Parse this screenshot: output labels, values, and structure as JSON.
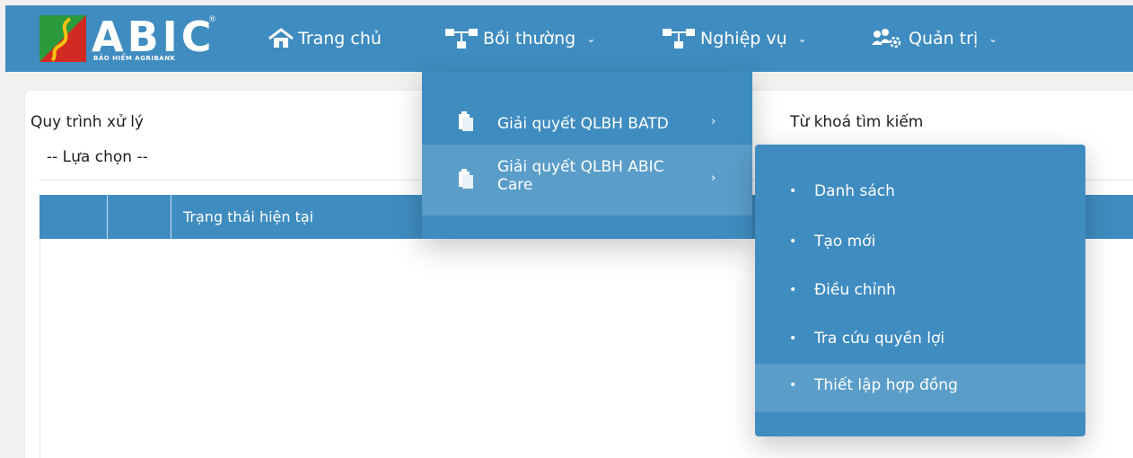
{
  "brand": {
    "name": "ABIC",
    "registered_mark": "®",
    "tagline": "BẢO HIỂM AGRIBANK",
    "colors": {
      "primary": "#3f8cc0",
      "logo_green": "#2a9a3c",
      "logo_red": "#d12a23"
    }
  },
  "nav": {
    "items": [
      {
        "label": "Trang chủ",
        "icon": "home-icon"
      },
      {
        "label": "Bồi thường",
        "icon": "hierarchy-icon",
        "chevron": "⌄"
      },
      {
        "label": "Nghiệp vụ",
        "icon": "hierarchy-icon",
        "chevron": "⌄"
      },
      {
        "label": "Quản trị",
        "icon": "users-gear-icon",
        "chevron": "⌄"
      }
    ]
  },
  "form": {
    "process_label": "Quy trình xử lý",
    "process_value": "-- Lựa chọn --",
    "keyword_label": "Từ khoá tìm kiếm"
  },
  "table": {
    "columns": [
      "",
      "",
      "Trạng thái hiện tại"
    ]
  },
  "menu_level1": {
    "items": [
      {
        "label": "Giải quyết QLBH BATD",
        "icon": "clipboard-icon",
        "chevron": "›"
      },
      {
        "label_line1": "Giải quyết QLBH ABIC",
        "label_line2": "Care",
        "icon": "clipboard-icon",
        "chevron": "›"
      }
    ]
  },
  "menu_level2": {
    "items": [
      {
        "label": "Danh sách",
        "bullet": "•"
      },
      {
        "label": "Tạo mới",
        "bullet": "•"
      },
      {
        "label": "Điều chỉnh",
        "bullet": "•"
      },
      {
        "label": "Tra cứu quyền lợi",
        "bullet": "•"
      },
      {
        "label": "Thiết lập hợp đồng",
        "bullet": "•"
      }
    ]
  }
}
